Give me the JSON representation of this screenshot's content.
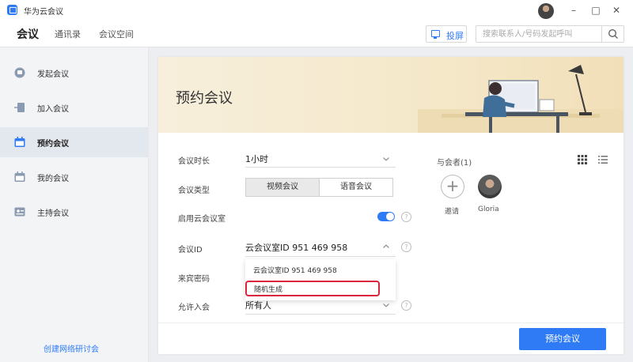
{
  "app": {
    "title": "华为云会议"
  },
  "nav": {
    "tabs": [
      {
        "label": "会议",
        "active": true
      },
      {
        "label": "通讯录",
        "active": false
      },
      {
        "label": "会议空间",
        "active": false
      }
    ],
    "project_label": "投屏",
    "search_placeholder": "搜索联系人/号码发起呼叫"
  },
  "sidebar": {
    "items": [
      {
        "label": "发起会议",
        "icon": "start-meeting-icon",
        "active": false
      },
      {
        "label": "加入会议",
        "icon": "join-meeting-icon",
        "active": false
      },
      {
        "label": "预约会议",
        "icon": "calendar-icon",
        "active": true
      },
      {
        "label": "我的会议",
        "icon": "my-meetings-icon",
        "active": false
      },
      {
        "label": "主持会议",
        "icon": "host-meeting-icon",
        "active": false
      }
    ],
    "webinar_link": "创建网络研讨会"
  },
  "form": {
    "title": "预约会议",
    "duration": {
      "label": "会议时长",
      "value": "1小时"
    },
    "type": {
      "label": "会议类型",
      "options": [
        "视频会议",
        "语音会议"
      ],
      "selected": "视频会议"
    },
    "cloud_room": {
      "label": "启用云会议室",
      "enabled": true
    },
    "meeting_id": {
      "label": "会议ID",
      "value": "云会议室ID 951 469 958"
    },
    "dropdown_options": [
      "云会议室ID 951 469 958",
      "随机生成"
    ],
    "guest_password": {
      "label": "来宾密码"
    },
    "allow_join": {
      "label": "允许入会",
      "value": "所有人"
    },
    "help_glyph": "?"
  },
  "attendees": {
    "label": "与会者(1)",
    "invite_label": "邀请",
    "invite_glyph": "+",
    "people": [
      {
        "name": "Gloria"
      }
    ]
  },
  "submit_label": "预约会议",
  "colors": {
    "accent": "#2f7bf6",
    "highlight": "#d7263d"
  }
}
